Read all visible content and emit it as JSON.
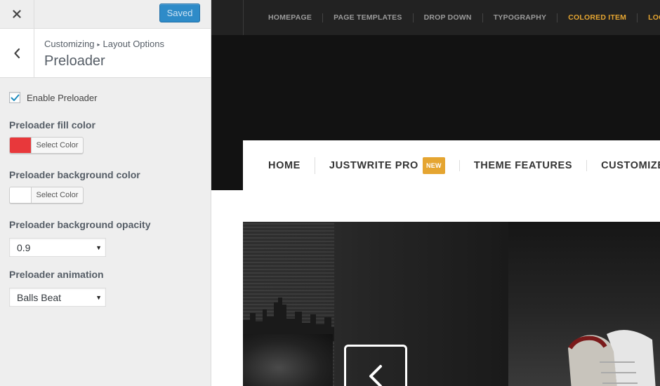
{
  "customizer": {
    "saved_label": "Saved",
    "breadcrumb": {
      "root": "Customizing",
      "separator": "▸",
      "parent": "Layout Options"
    },
    "section_title": "Preloader",
    "enable": {
      "label": "Enable Preloader",
      "checked": true
    },
    "fill_color": {
      "title": "Preloader fill color",
      "button_label": "Select Color",
      "value": "#e8383b"
    },
    "background_color": {
      "title": "Preloader background color",
      "button_label": "Select Color",
      "value": "#ffffff"
    },
    "opacity": {
      "title": "Preloader background opacity",
      "value": "0.9"
    },
    "animation": {
      "title": "Preloader animation",
      "value": "Balls Beat"
    }
  },
  "preview": {
    "top_menu": [
      {
        "label": "HOMEPAGE",
        "colored": false
      },
      {
        "label": "PAGE TEMPLATES",
        "colored": false
      },
      {
        "label": "DROP DOWN",
        "colored": false
      },
      {
        "label": "TYPOGRAPHY",
        "colored": false
      },
      {
        "label": "COLORED ITEM",
        "colored": true
      },
      {
        "label": "LOGIN",
        "colored": true
      }
    ],
    "main_menu": [
      {
        "label": "HOME"
      },
      {
        "label": "JUSTWRITE PRO",
        "badge": "NEW"
      },
      {
        "label": "THEME FEATURES"
      },
      {
        "label": "CUSTOMIZER"
      }
    ]
  },
  "colors": {
    "accent": "#e5a531",
    "saved_button": "#2e8bc8",
    "checkbox_check": "#1e8cbe"
  },
  "icons": {
    "close": "close-icon",
    "back": "chevron-left-icon",
    "check": "checkmark-icon",
    "dropdown": "caret-down-icon",
    "slider_prev": "chevron-left-icon"
  }
}
